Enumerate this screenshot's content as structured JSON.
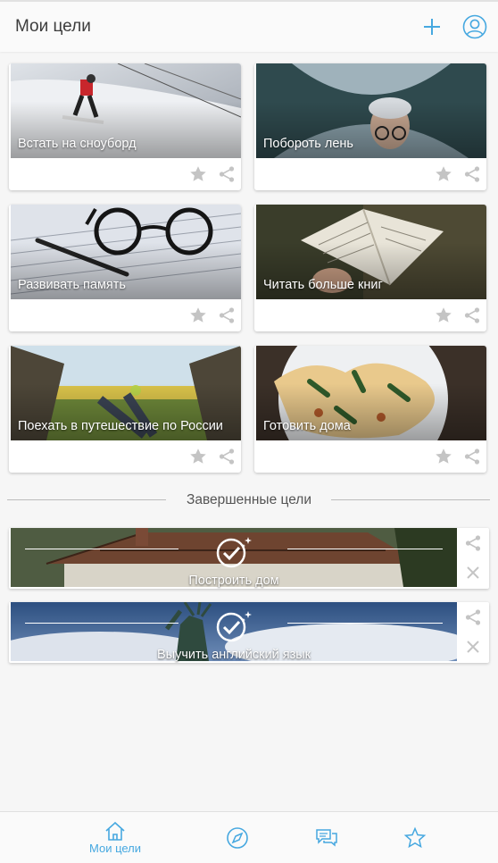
{
  "header": {
    "title": "Мои цели",
    "add_icon": "plus-icon",
    "profile_icon": "profile-icon"
  },
  "accent_color": "#46a8e0",
  "goals": [
    {
      "title": "Встать на сноуборд"
    },
    {
      "title": "Побороть лень"
    },
    {
      "title": "Развивать память"
    },
    {
      "title": "Читать больше книг"
    },
    {
      "title": "Поехать в путешествие по России"
    },
    {
      "title": "Готовить дома"
    }
  ],
  "completed": {
    "heading": "Завершенные цели",
    "items": [
      {
        "title": "Построить дом"
      },
      {
        "title": "Выучить английский язык"
      }
    ]
  },
  "tabbar": {
    "items": [
      {
        "label": "Мои цели",
        "icon": "home-icon",
        "active": true
      },
      {
        "label": "",
        "icon": "compass-icon"
      },
      {
        "label": "",
        "icon": "chat-icon"
      },
      {
        "label": "",
        "icon": "star-icon"
      }
    ]
  }
}
